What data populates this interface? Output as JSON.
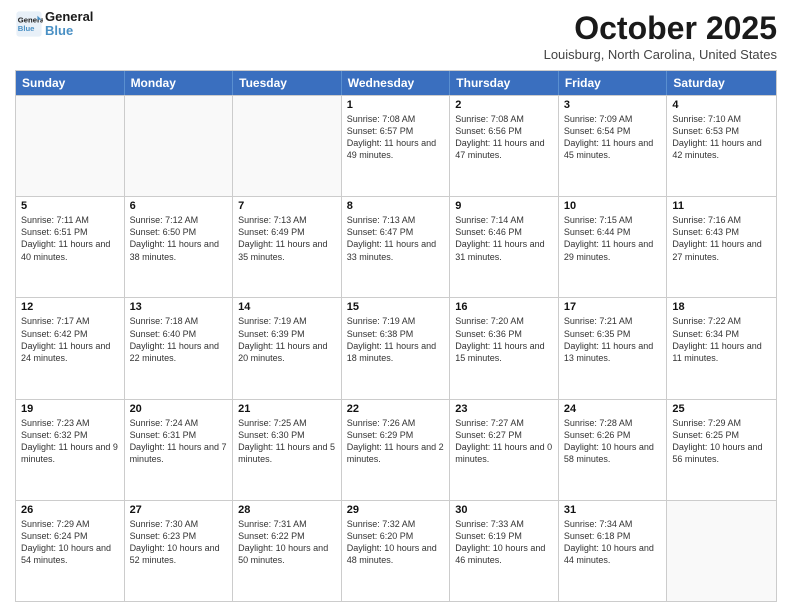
{
  "header": {
    "logo_line1": "General",
    "logo_line2": "Blue",
    "month_title": "October 2025",
    "location": "Louisburg, North Carolina, United States"
  },
  "days_of_week": [
    "Sunday",
    "Monday",
    "Tuesday",
    "Wednesday",
    "Thursday",
    "Friday",
    "Saturday"
  ],
  "weeks": [
    [
      {
        "day": "",
        "empty": true
      },
      {
        "day": "",
        "empty": true
      },
      {
        "day": "",
        "empty": true
      },
      {
        "day": "1",
        "sunrise": "7:08 AM",
        "sunset": "6:57 PM",
        "daylight": "11 hours and 49 minutes."
      },
      {
        "day": "2",
        "sunrise": "7:08 AM",
        "sunset": "6:56 PM",
        "daylight": "11 hours and 47 minutes."
      },
      {
        "day": "3",
        "sunrise": "7:09 AM",
        "sunset": "6:54 PM",
        "daylight": "11 hours and 45 minutes."
      },
      {
        "day": "4",
        "sunrise": "7:10 AM",
        "sunset": "6:53 PM",
        "daylight": "11 hours and 42 minutes."
      }
    ],
    [
      {
        "day": "5",
        "sunrise": "7:11 AM",
        "sunset": "6:51 PM",
        "daylight": "11 hours and 40 minutes."
      },
      {
        "day": "6",
        "sunrise": "7:12 AM",
        "sunset": "6:50 PM",
        "daylight": "11 hours and 38 minutes."
      },
      {
        "day": "7",
        "sunrise": "7:13 AM",
        "sunset": "6:49 PM",
        "daylight": "11 hours and 35 minutes."
      },
      {
        "day": "8",
        "sunrise": "7:13 AM",
        "sunset": "6:47 PM",
        "daylight": "11 hours and 33 minutes."
      },
      {
        "day": "9",
        "sunrise": "7:14 AM",
        "sunset": "6:46 PM",
        "daylight": "11 hours and 31 minutes."
      },
      {
        "day": "10",
        "sunrise": "7:15 AM",
        "sunset": "6:44 PM",
        "daylight": "11 hours and 29 minutes."
      },
      {
        "day": "11",
        "sunrise": "7:16 AM",
        "sunset": "6:43 PM",
        "daylight": "11 hours and 27 minutes."
      }
    ],
    [
      {
        "day": "12",
        "sunrise": "7:17 AM",
        "sunset": "6:42 PM",
        "daylight": "11 hours and 24 minutes."
      },
      {
        "day": "13",
        "sunrise": "7:18 AM",
        "sunset": "6:40 PM",
        "daylight": "11 hours and 22 minutes."
      },
      {
        "day": "14",
        "sunrise": "7:19 AM",
        "sunset": "6:39 PM",
        "daylight": "11 hours and 20 minutes."
      },
      {
        "day": "15",
        "sunrise": "7:19 AM",
        "sunset": "6:38 PM",
        "daylight": "11 hours and 18 minutes."
      },
      {
        "day": "16",
        "sunrise": "7:20 AM",
        "sunset": "6:36 PM",
        "daylight": "11 hours and 15 minutes."
      },
      {
        "day": "17",
        "sunrise": "7:21 AM",
        "sunset": "6:35 PM",
        "daylight": "11 hours and 13 minutes."
      },
      {
        "day": "18",
        "sunrise": "7:22 AM",
        "sunset": "6:34 PM",
        "daylight": "11 hours and 11 minutes."
      }
    ],
    [
      {
        "day": "19",
        "sunrise": "7:23 AM",
        "sunset": "6:32 PM",
        "daylight": "11 hours and 9 minutes."
      },
      {
        "day": "20",
        "sunrise": "7:24 AM",
        "sunset": "6:31 PM",
        "daylight": "11 hours and 7 minutes."
      },
      {
        "day": "21",
        "sunrise": "7:25 AM",
        "sunset": "6:30 PM",
        "daylight": "11 hours and 5 minutes."
      },
      {
        "day": "22",
        "sunrise": "7:26 AM",
        "sunset": "6:29 PM",
        "daylight": "11 hours and 2 minutes."
      },
      {
        "day": "23",
        "sunrise": "7:27 AM",
        "sunset": "6:27 PM",
        "daylight": "11 hours and 0 minutes."
      },
      {
        "day": "24",
        "sunrise": "7:28 AM",
        "sunset": "6:26 PM",
        "daylight": "10 hours and 58 minutes."
      },
      {
        "day": "25",
        "sunrise": "7:29 AM",
        "sunset": "6:25 PM",
        "daylight": "10 hours and 56 minutes."
      }
    ],
    [
      {
        "day": "26",
        "sunrise": "7:29 AM",
        "sunset": "6:24 PM",
        "daylight": "10 hours and 54 minutes."
      },
      {
        "day": "27",
        "sunrise": "7:30 AM",
        "sunset": "6:23 PM",
        "daylight": "10 hours and 52 minutes."
      },
      {
        "day": "28",
        "sunrise": "7:31 AM",
        "sunset": "6:22 PM",
        "daylight": "10 hours and 50 minutes."
      },
      {
        "day": "29",
        "sunrise": "7:32 AM",
        "sunset": "6:20 PM",
        "daylight": "10 hours and 48 minutes."
      },
      {
        "day": "30",
        "sunrise": "7:33 AM",
        "sunset": "6:19 PM",
        "daylight": "10 hours and 46 minutes."
      },
      {
        "day": "31",
        "sunrise": "7:34 AM",
        "sunset": "6:18 PM",
        "daylight": "10 hours and 44 minutes."
      },
      {
        "day": "",
        "empty": true
      }
    ]
  ]
}
